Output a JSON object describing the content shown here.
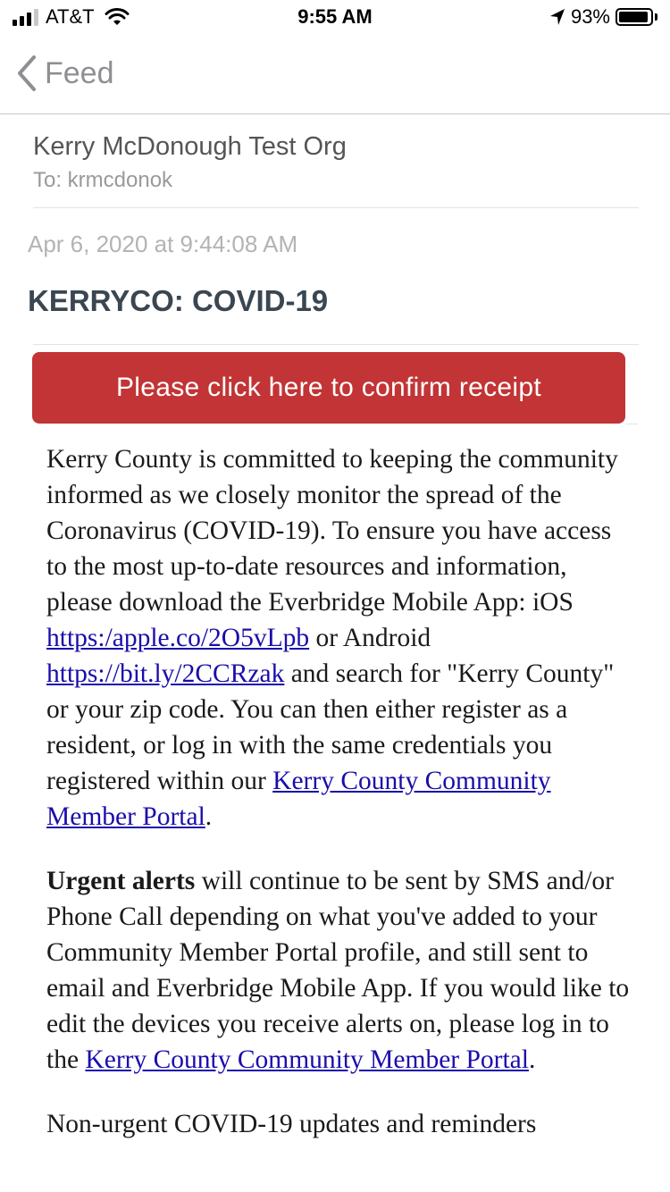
{
  "status_bar": {
    "carrier": "AT&T",
    "time": "9:55 AM",
    "battery_percent": "93%",
    "battery_level": 0.93,
    "signal_bars_active": 3,
    "icons": [
      "signal-icon",
      "wifi-icon",
      "location-arrow-icon",
      "battery-icon"
    ]
  },
  "nav": {
    "back_label": "Feed",
    "back_icon": "chevron-left-icon"
  },
  "message": {
    "sender": "Kerry McDonough Test Org",
    "recipient": "To: krmcdonok",
    "date": "Apr 6, 2020 at 9:44:08 AM",
    "subject": "KERRYCO: COVID-19",
    "confirm_button": "Please click here to confirm receipt",
    "paragraph1": {
      "text1": "Kerry County is committed to keeping the community informed as we closely monitor the spread of the Coronavirus (COVID-19). To ensure you have access to the most up-to-date resources and information, please download the Everbridge Mobile App: iOS ",
      "link_ios": "https:/apple.co/2O5vLpb",
      "text2": " or Android ",
      "link_android": "https://bit.ly/2CCRzak",
      "text3": " and search for \"Kerry County\" or your zip code. You can then either register as a resident, or log in with the same credentials you registered within our ",
      "link_portal": "Kerry County Community Member Portal",
      "text4": "."
    },
    "paragraph2": {
      "bold": "Urgent alerts",
      "text1": " will continue to be sent by SMS and/or Phone Call depending on what you've added to your Community Member Portal profile, and still sent to email and Everbridge Mobile App. If you would like to edit the devices you receive alerts on, please log in to the ",
      "link_portal": "Kerry County Community Member Portal",
      "text2": "."
    },
    "paragraph3_partial": "Non-urgent COVID-19 updates and reminders"
  },
  "colors": {
    "confirm_button_bg": "#c23435",
    "link": "#1a0dab",
    "subject": "#3a4651"
  }
}
